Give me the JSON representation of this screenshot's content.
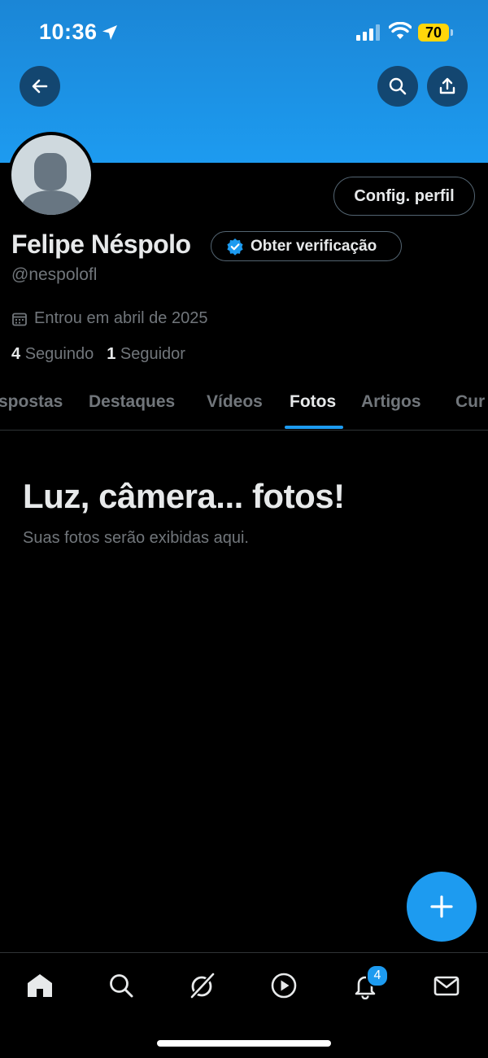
{
  "status_bar": {
    "time": "10:36",
    "battery": "70"
  },
  "profile": {
    "edit_label": "Config. perfil",
    "name": "Felipe Néspolo",
    "verify_label": "Obter verificação",
    "handle": "@nespolofl",
    "joined": "Entrou em abril de 2025",
    "following_count": "4",
    "following_label": "Seguindo",
    "followers_count": "1",
    "followers_label": "Seguidor"
  },
  "tabs": [
    {
      "label": "spostas"
    },
    {
      "label": "Destaques"
    },
    {
      "label": "Vídeos"
    },
    {
      "label": "Fotos",
      "active": true
    },
    {
      "label": "Artigos"
    },
    {
      "label": "Cur"
    }
  ],
  "empty_state": {
    "title": "Luz, câmera... fotos!",
    "subtitle": "Suas fotos serão exibidas aqui."
  },
  "bottom_nav": {
    "items": [
      "home-icon",
      "search-icon",
      "grok-icon",
      "video-icon",
      "notifications-icon",
      "messages-icon"
    ],
    "notification_badge": "4"
  },
  "colors": {
    "accent": "#1d9bf0",
    "background": "#000000",
    "muted": "#71767b",
    "text": "#e7e9ea"
  }
}
